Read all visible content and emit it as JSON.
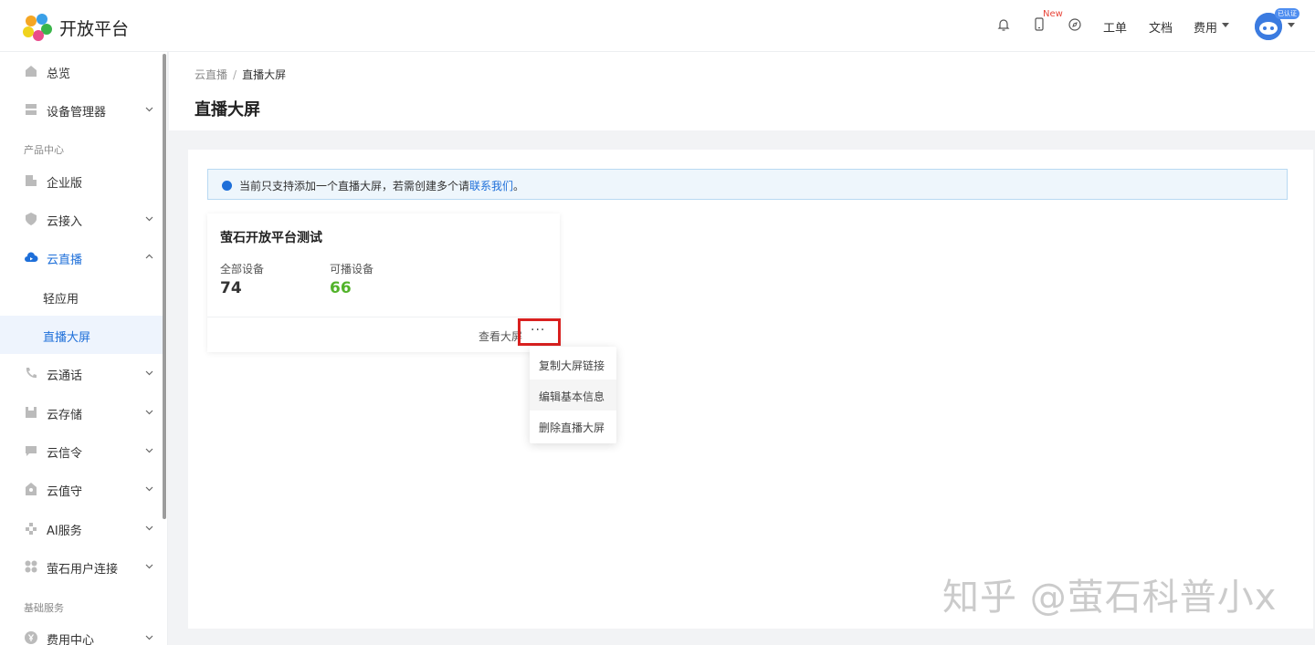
{
  "topbar": {
    "brand": "开放平台",
    "new_badge": "New",
    "links": {
      "ticket": "工单",
      "docs": "文档",
      "billing": "费用"
    },
    "avatar_badge": "已认证",
    "icons": [
      "bell-icon",
      "mobile-icon",
      "compass-icon",
      "avatar-icon"
    ]
  },
  "sidebar": {
    "group_product": "产品中心",
    "group_basic": "基础服务",
    "items": {
      "overview": "总览",
      "device_manager": "设备管理器",
      "enterprise": "企业版",
      "cloud_access": "云接入",
      "cloud_live": "云直播",
      "light_app": "轻应用",
      "live_screen": "直播大屏",
      "cloud_call": "云通话",
      "cloud_storage": "云存储",
      "cloud_signal": "云信令",
      "cloud_guard": "云值守",
      "ai_service": "AI服务",
      "user_connect": "萤石用户连接",
      "billing_center": "费用中心"
    }
  },
  "breadcrumb": {
    "parent": "云直播",
    "separator": "/",
    "current": "直播大屏"
  },
  "page_title": "直播大屏",
  "alert": {
    "text": "当前只支持添加一个直播大屏，若需创建多个请",
    "link": "联系我们",
    "suffix": "。"
  },
  "card": {
    "title": "萤石开放平台测试",
    "all_devices_label": "全部设备",
    "all_devices_value": "74",
    "playable_label": "可播设备",
    "playable_value": "66",
    "view_label": "查看大屏",
    "more_label": "···"
  },
  "dropdown": {
    "items": [
      "复制大屏链接",
      "编辑基本信息",
      "删除直播大屏"
    ]
  },
  "watermark": "知乎 @萤石科普小x",
  "colors": {
    "accent": "#1e6fd9",
    "success": "#52b32a",
    "highlight_border": "#d9201f"
  }
}
